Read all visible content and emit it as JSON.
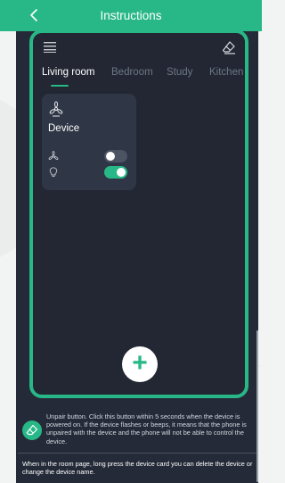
{
  "titlebar": {
    "title": "Instructions",
    "back_icon": "chevron-left-icon"
  },
  "room": {
    "tabs": [
      {
        "label": "Living room",
        "active": true
      },
      {
        "label": "Bedroom",
        "active": false
      },
      {
        "label": "Study",
        "active": false
      },
      {
        "label": "Kitchen",
        "active": false
      }
    ],
    "menu_icon": "menu-icon",
    "erase_icon": "eraser-icon"
  },
  "device_card": {
    "icon": "fan-icon",
    "name": "Device",
    "rows": [
      {
        "icon": "fan-icon",
        "state": "off"
      },
      {
        "icon": "bulb-icon",
        "state": "on"
      }
    ]
  },
  "add_button": {
    "label": "+"
  },
  "help": {
    "unpair_text": "Unpair button. Click this button within 5 seconds when the device is powered on. If the device flashes or beeps, it means that the phone is unpaired with the device and the phone will not be able to control the device.",
    "room_text": "When in the room page, long press the device card you can delete the device or change the device name."
  },
  "colors": {
    "accent": "#28b887",
    "overlay": "#242a38",
    "card": "#2f3645",
    "toggle_off": "#4c5363"
  }
}
